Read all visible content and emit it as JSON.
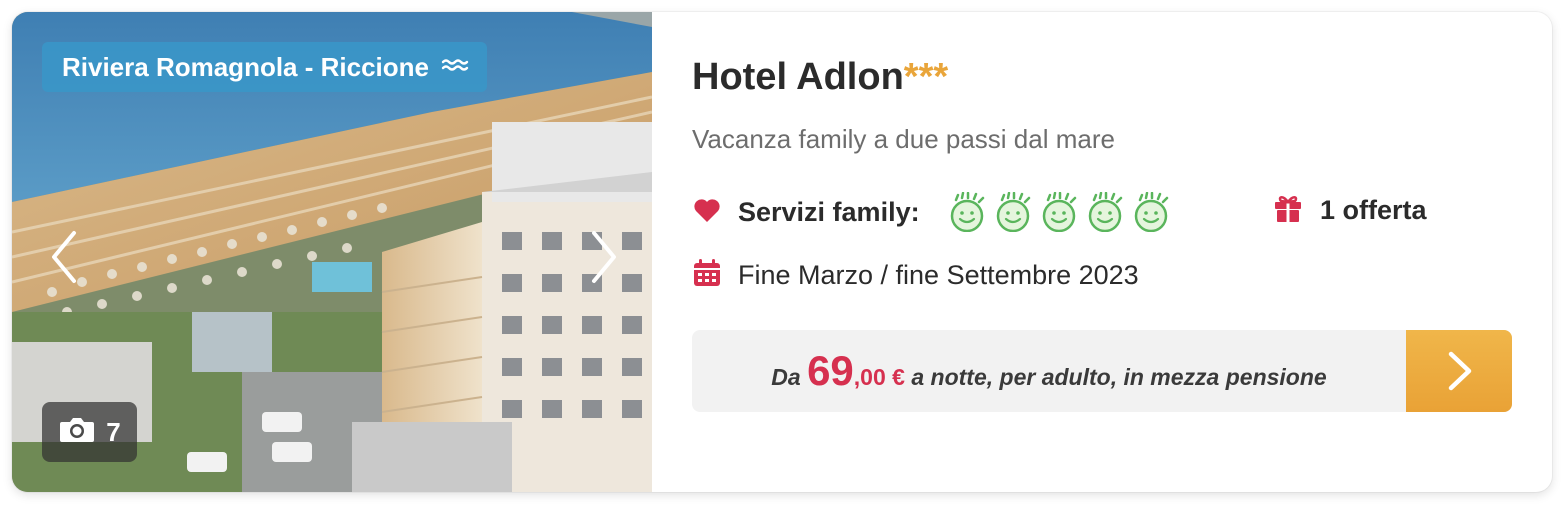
{
  "hotel": {
    "location": "Riviera Romagnola - Riccione",
    "photo_count": "7",
    "name": "Hotel Adlon",
    "stars": "***",
    "subtitle": "Vacanza family a due passi dal mare",
    "services_label": "Servizi family:",
    "family_rating": 5,
    "offers": "1 offerta",
    "season": "Fine Marzo / fine Settembre 2023"
  },
  "price": {
    "prefix": "Da ",
    "integer": "69",
    "decimal": ",00",
    "currency": " €",
    "suffix": " a notte, per adulto, in mezza pensione"
  },
  "colors": {
    "accent_red": "#d6304f",
    "star_gold": "#e9a53a",
    "button_orange": "#eda93e",
    "badge_blue": "#3a96c8",
    "smiley_green": "#5ab55c"
  },
  "icons": {
    "location": "waves-icon",
    "photos": "camera-icon",
    "services": "heart-icon",
    "offer": "gift-icon",
    "season": "calendar-icon",
    "cta": "chevron-right-icon"
  }
}
